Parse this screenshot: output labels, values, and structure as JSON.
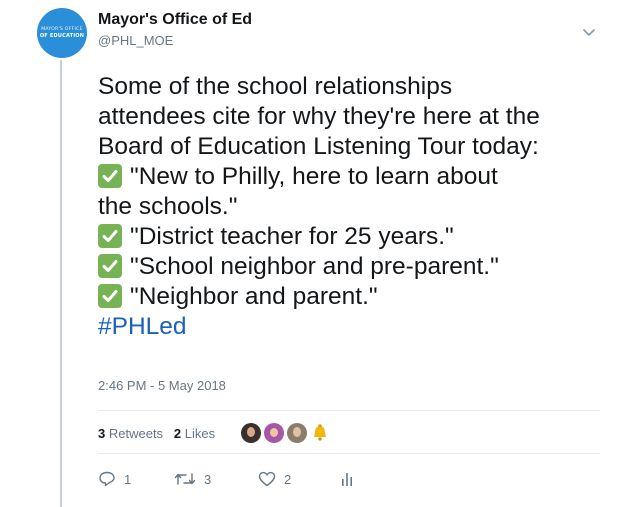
{
  "account": {
    "avatar_line1": "MAYOR'S OFFICE",
    "avatar_line2": "OF EDUCATION",
    "name": "Mayor's Office of Ed",
    "handle": "@PHL_MOE"
  },
  "tweet": {
    "lines": [
      "Some of the school relationships",
      "attendees cite for why they're here at the",
      "Board of Education Listening Tour today:",
      "\"New to Philly, here to learn about",
      "the schools.\"",
      "\"District teacher for 25 years.\"",
      "\"School neighbor and pre-parent.\"",
      "\"Neighbor and parent.\""
    ],
    "hashtag": "#PHLed",
    "timestamp": "2:46 PM - 5 May 2018"
  },
  "stats": {
    "retweets_count": "3",
    "retweets_label": "Retweets",
    "likes_count": "2",
    "likes_label": "Likes"
  },
  "actions": {
    "reply_count": "1",
    "retweet_count": "3",
    "like_count": "2"
  },
  "colors": {
    "check_green": "#77b255",
    "hashtag_blue": "#1b5fbf",
    "avatar_blue": "#2a8fd8"
  }
}
